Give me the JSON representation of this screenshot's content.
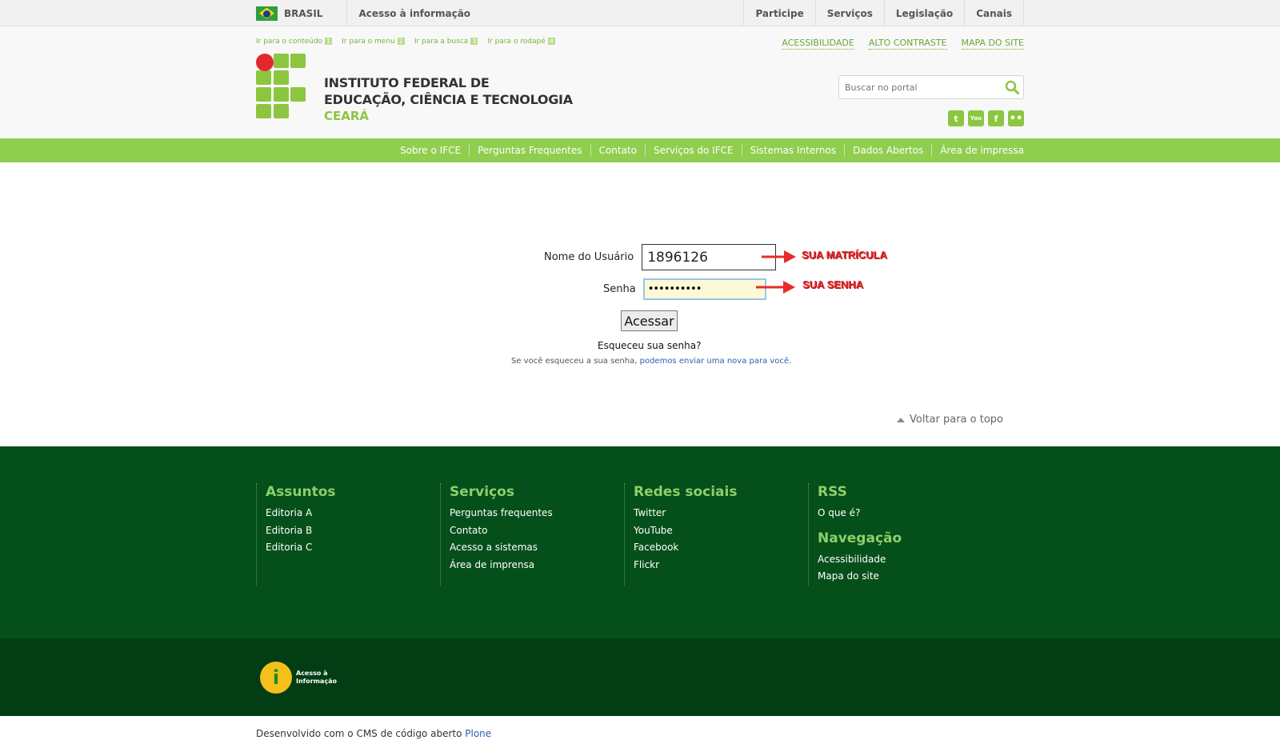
{
  "gov_bar": {
    "country": "BRASIL",
    "access_info": "Acesso à informação",
    "links": [
      "Participe",
      "Serviços",
      "Legislação",
      "Canais"
    ]
  },
  "header": {
    "skip_links": [
      {
        "label": "Ir para o conteúdo",
        "key": "1"
      },
      {
        "label": "Ir para o menu",
        "key": "2"
      },
      {
        "label": "Ir para a busca",
        "key": "3"
      },
      {
        "label": "Ir para o rodapé",
        "key": "4"
      }
    ],
    "access_links": [
      "ACESSIBILIDADE",
      "ALTO CONTRASTE",
      "MAPA DO SITE"
    ],
    "title_line1": "INSTITUTO FEDERAL DE",
    "title_line2": "EDUCAÇÃO, CIÊNCIA E TECNOLOGIA",
    "title_line3": "CEARÁ",
    "search_placeholder": "Buscar no portal",
    "social_icons": [
      "twitter-icon",
      "youtube-icon",
      "facebook-icon",
      "flickr-icon"
    ]
  },
  "nav": {
    "items": [
      "Sobre o IFCE",
      "Perguntas Frequentes",
      "Contato",
      "Serviços do IFCE",
      "Sistemas Internos",
      "Dados Abertos",
      "Área de impressa"
    ]
  },
  "login": {
    "username_label": "Nome do Usuário",
    "username_value": "1896126",
    "password_label": "Senha",
    "password_value": "••••••••••",
    "submit_label": "Acessar",
    "forgot_title": "Esqueceu sua senha?",
    "forgot_text": "Se você esqueceu a sua senha, ",
    "forgot_link": "podemos enviar uma nova para você",
    "forgot_end": ".",
    "annotation_user": "SUA MATRÍCULA",
    "annotation_pass": "SUA SENHA"
  },
  "back_to_top": "Voltar para o topo",
  "footer": {
    "columns": [
      {
        "title": "Assuntos",
        "items": [
          "Editoria A",
          "Editoria B",
          "Editoria C"
        ]
      },
      {
        "title": "Serviços",
        "items": [
          "Perguntas frequentes",
          "Contato",
          "Acesso a sistemas",
          "Área de imprensa"
        ]
      },
      {
        "title": "Redes sociais",
        "items": [
          "Twitter",
          "YouTube",
          "Facebook",
          "Flickr"
        ]
      },
      {
        "title": "RSS",
        "items": [
          "O que é?"
        ],
        "title2": "Navegação",
        "items2": [
          "Acessibilidade",
          "Mapa do site"
        ]
      }
    ],
    "ai_logo_line1": "Acesso à",
    "ai_logo_line2": "Informação"
  },
  "credits": {
    "text": "Desenvolvido com o CMS de código aberto ",
    "link": "Plone"
  },
  "colors": {
    "brand_green": "#8cc63f",
    "nav_green": "#8fce4f",
    "footer_green": "#05501a",
    "logo_red": "#e4272e",
    "annotation_red": "#e52b2b"
  }
}
